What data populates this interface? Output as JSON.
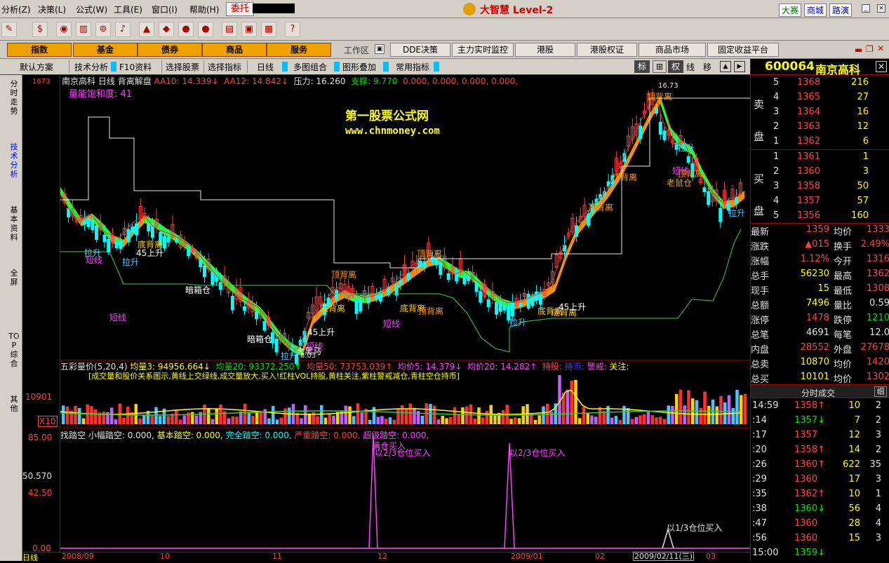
{
  "menu": {
    "items": [
      "分析(Z)",
      "决策(L)",
      "公式(W)",
      "工具(E)",
      "窗口(I)",
      "帮助(H)"
    ],
    "entrust": "委托",
    "app_title": "大智慧 Level-2",
    "right_buttons": [
      "大赛",
      "商城",
      "路演"
    ]
  },
  "nav": {
    "buttons": [
      "指数",
      "基金",
      "债券",
      "商品",
      "服务"
    ],
    "workspace": "工作区",
    "links": [
      "DDE决策",
      "主力实时监控",
      "港股",
      "港股权证",
      "商品市场",
      "固定收益平台"
    ]
  },
  "ctrl": {
    "items": [
      "默认方案",
      "技术分析",
      "F10资料",
      "选择股票",
      "选择指标",
      "日线",
      "多图组合",
      "图形叠加",
      "常用指标"
    ],
    "right_icons": [
      "标",
      "⊞",
      "权",
      "线",
      "移"
    ]
  },
  "left_tabs": [
    "分时走势",
    "技术分析",
    "基本资料",
    "全屏",
    "TOP综合",
    "其他"
  ],
  "main_panel": {
    "header": {
      "stock": "南京高科",
      "period": "日线",
      "indicator": "背离解盘",
      "aa10": "AA10: 14.339↓",
      "aa12": "AA12: 14.842↓",
      "pressure": "压力: 16.260",
      "support": "支撑: 9.770",
      "zeros": "0.000, 0.000, 0.000, 0.000,"
    },
    "saturation": "量能饱和度: 41",
    "watermark1": "第一股票公式网",
    "watermark2": "www.chnmoney.com",
    "peak_label": "16.73",
    "low_label": "8.03",
    "y_top": "1673"
  },
  "vol_panel": {
    "header": {
      "name": "五彩量价(5,20,4)",
      "v3": "均量3: 94956.664↓",
      "v20": "均量20: 93372.250↑",
      "v50": "均量50: 73753.039↑",
      "p5": "均价5: 14.379↓",
      "p20": "均价20: 14.282↑",
      "hold": "持股:",
      "holdcoin": "持币:",
      "warn": "警戒:",
      "focus": "关注:"
    },
    "desc": "[成交量和股价关系图示,黄线上交绿线,成交量放大,买入!红柱VOL持股,黄柱关注,紫柱警戒减仓,青柱空仓持币]",
    "y_label": "10901",
    "x_label": "X10"
  },
  "gap_panel": {
    "header": {
      "name": "找踏空",
      "small": "小幅踏空: 0.000,",
      "basic": "基本踏空: 0.000,",
      "full": "完全踏空: 0.000,",
      "severe": "严重踏空: 0.000,",
      "super": "超级踏空: 0.000,"
    },
    "y_labels": [
      "85.00",
      "50.570",
      "42.50",
      "0.00"
    ],
    "signals": [
      "满仓买入",
      "以2/3仓位买入",
      "以2/3仓位买入",
      "以1/3仓位买入"
    ]
  },
  "chart_labels": [
    "拉升",
    "短线",
    "拉升",
    "45上升",
    "底背离",
    "暗箱仓",
    "顶背离",
    "短线",
    "底背离",
    "短线",
    "暗箱仓",
    "短线",
    "拉升",
    "45上升",
    "大黑马",
    "顶背离",
    "底背离",
    "顶背离",
    "底背离",
    "拉升",
    "45上升",
    "底背离",
    "顶背离",
    "顶背离",
    "顶背离",
    "顶背离",
    "短线",
    "老鼠仓",
    "拉升",
    "拉升"
  ],
  "x_axis": {
    "period": "日线",
    "dates": [
      "2008/09",
      "10",
      "11",
      "12",
      "2009/01",
      "02",
      "2009/02/11(三)",
      "03"
    ]
  },
  "quote": {
    "code": "600064",
    "name": "南京高科",
    "sell_label": "卖盘",
    "buy_label": "买盘",
    "asks": [
      {
        "n": "5",
        "p": "1368",
        "v": "216"
      },
      {
        "n": "4",
        "p": "1365",
        "v": "27"
      },
      {
        "n": "3",
        "p": "1364",
        "v": "16"
      },
      {
        "n": "2",
        "p": "1363",
        "v": "12"
      },
      {
        "n": "1",
        "p": "1362",
        "v": "6"
      }
    ],
    "bids": [
      {
        "n": "1",
        "p": "1361",
        "v": "1"
      },
      {
        "n": "2",
        "p": "1360",
        "v": "3"
      },
      {
        "n": "3",
        "p": "1358",
        "v": "50"
      },
      {
        "n": "4",
        "p": "1357",
        "v": "57"
      },
      {
        "n": "5",
        "p": "1356",
        "v": "160"
      }
    ],
    "stats": [
      {
        "k1": "最新",
        "v1": "1359",
        "k2": "均价",
        "v2": "1333"
      },
      {
        "k1": "涨跌",
        "v1": "▲015",
        "k2": "换手",
        "v2": "2.49%"
      },
      {
        "k1": "涨幅",
        "v1": "1.12%",
        "k2": "今开",
        "v2": "1316"
      },
      {
        "k1": "总手",
        "v1": "56230",
        "k2": "最高",
        "v2": "1362"
      },
      {
        "k1": "现手",
        "v1": "15",
        "k2": "最低",
        "v2": "1308"
      },
      {
        "k1": "总额",
        "v1": "7496",
        "k2": "量比",
        "v2": "0.59"
      },
      {
        "k1": "涨停",
        "v1": "1478",
        "k2": "跌停",
        "v2": "1210"
      },
      {
        "k1": "总笔",
        "v1": "4691",
        "k2": "每笔",
        "v2": "12.0"
      },
      {
        "k1": "内盘",
        "v1": "28552",
        "k2": "外盘",
        "v2": "27678"
      },
      {
        "k1": "总卖",
        "v1": "10870",
        "k2": "均价",
        "v2": "1420"
      },
      {
        "k1": "总买",
        "v1": "10101",
        "k2": "均价",
        "v2": "1302"
      }
    ],
    "tick_title": "分时成交",
    "tick_btn": "细",
    "ticks": [
      {
        "t": "14:59",
        "p": "1358↑",
        "v": "10",
        "c": "2"
      },
      {
        "t": ":14",
        "p": "1357↓",
        "v": "7",
        "c": "2"
      },
      {
        "t": ":17",
        "p": "1357",
        "v": "12",
        "c": "3"
      },
      {
        "t": ":20",
        "p": "1358↑",
        "v": "14",
        "c": "2"
      },
      {
        "t": ":26",
        "p": "1360↑",
        "v": "622",
        "c": "35"
      },
      {
        "t": ":29",
        "p": "1360",
        "v": "17",
        "c": "3"
      },
      {
        "t": ":35",
        "p": "1362↑",
        "v": "10",
        "c": "1"
      },
      {
        "t": ":38",
        "p": "1360↓",
        "v": "56",
        "c": "4"
      },
      {
        "t": ":47",
        "p": "1360",
        "v": "28",
        "c": "4"
      },
      {
        "t": ":56",
        "p": "1360",
        "v": "15",
        "c": "3"
      },
      {
        "t": "15:00",
        "p": "1359↓",
        "v": "",
        "c": ""
      }
    ]
  },
  "colors": {
    "up": "#ff4040",
    "down": "#00ffff",
    "band_up": "#ff9900",
    "band_down": "#33ff33"
  }
}
